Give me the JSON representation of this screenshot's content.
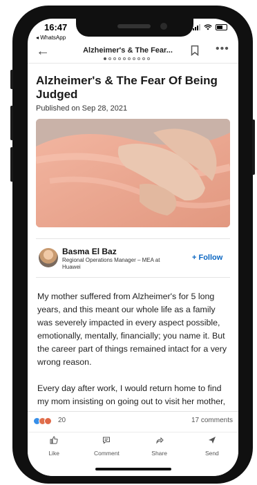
{
  "status_bar": {
    "time": "16:47",
    "back_app": "◂ WhatsApp"
  },
  "header": {
    "title": "Alzheimer's & The Fear...",
    "page_dots": 10,
    "active_dot": 0
  },
  "article": {
    "title": "Alzheimer's & The Fear Of Being Judged",
    "published": "Published on Sep 28, 2021",
    "image_alt": "hands-on-shoulder-photo"
  },
  "author": {
    "name": "Basma El Baz",
    "role": "Regional Operations Manager – MEA at Huawei",
    "follow_label": "+ Follow"
  },
  "body": {
    "paragraphs": [
      "My mother suffered from Alzheimer's for 5 long years, and this meant our whole life as a family was severely impacted in every aspect possible, emotionally, mentally, financially; you name it. But the career part of things remained intact for a very wrong reason.",
      "Every day after work, I would return home to find my mom insisting on going out to visit her mother, who passed away many years ago, and"
    ]
  },
  "social": {
    "reaction_count": "20",
    "comments": "17 comments",
    "reaction_colors": [
      "#378fe9",
      "#df704d",
      "#e06847"
    ]
  },
  "actions": [
    {
      "label": "Like",
      "icon": "thumbs-up-icon"
    },
    {
      "label": "Comment",
      "icon": "comment-icon"
    },
    {
      "label": "Share",
      "icon": "share-icon"
    },
    {
      "label": "Send",
      "icon": "send-icon"
    }
  ]
}
